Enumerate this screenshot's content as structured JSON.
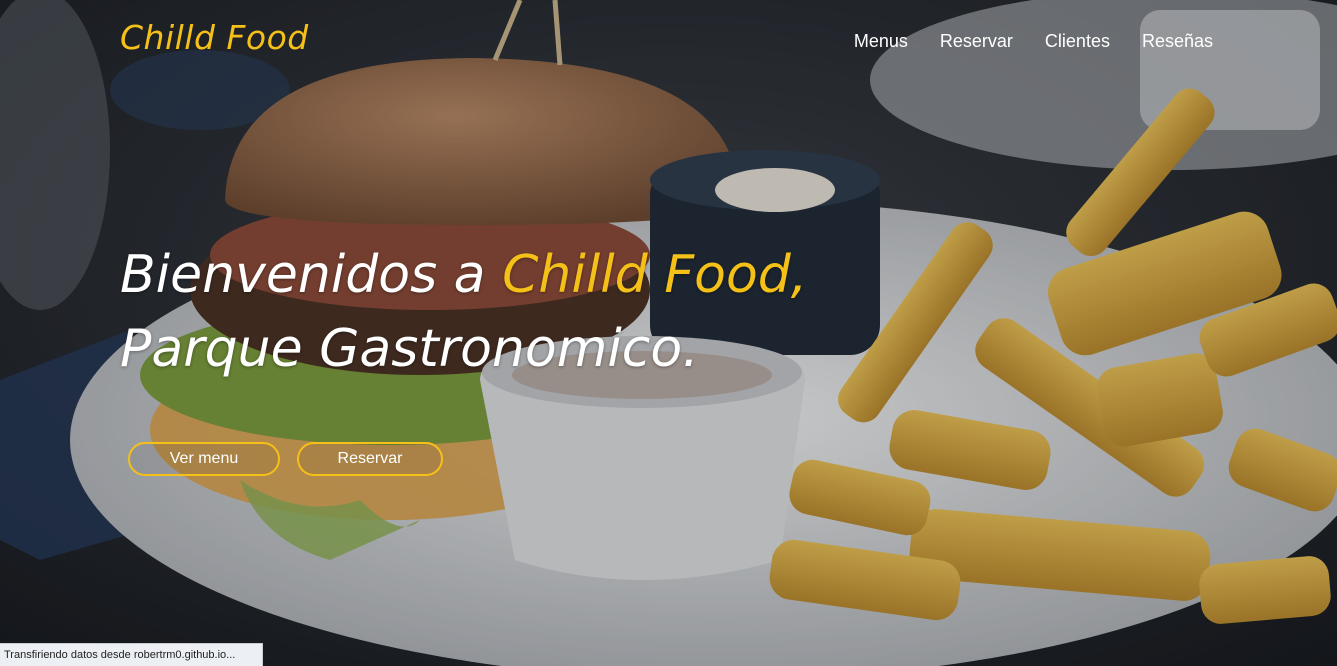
{
  "header": {
    "logo": "Chilld Food",
    "nav": [
      "Menus",
      "Reservar",
      "Clientes",
      "Reseñas"
    ]
  },
  "hero": {
    "line1_prefix": "Bienvenidos a ",
    "line1_accent": "Chilld Food,",
    "line2": "Parque Gastronomico.",
    "buttons": {
      "menu": "Ver menu",
      "reservar": "Reservar"
    },
    "background_image": "burger-and-fries-photo"
  },
  "status_bar": {
    "text": "Transfiriendo datos desde robertrm0.github.io..."
  },
  "colors": {
    "accent": "#f5c018",
    "text": "#ffffff"
  }
}
